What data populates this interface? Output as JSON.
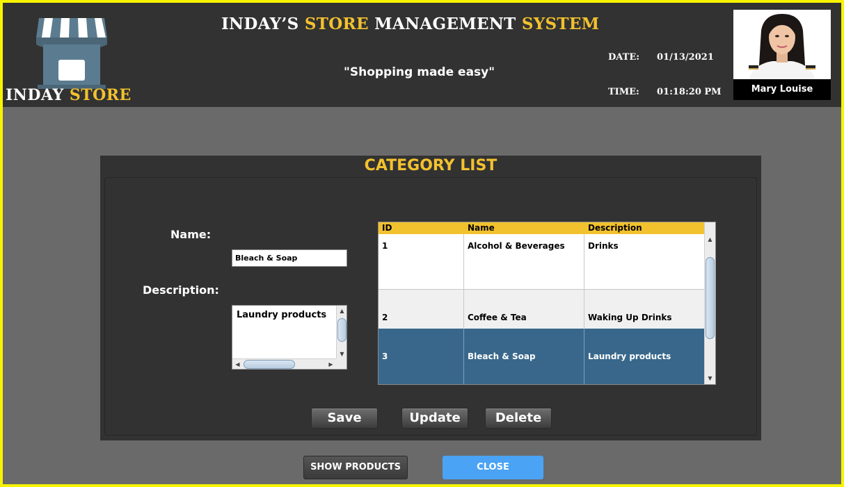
{
  "header": {
    "logo_text": {
      "part1": "INDAY ",
      "part2": "STORE"
    },
    "title": {
      "w1": "INDAY’S ",
      "w2": "STORE",
      "w3": " MANAGEMENT ",
      "w4": "SYSTEM"
    },
    "tagline": "\"Shopping made easy\"",
    "date_label": "DATE:",
    "date_value": "01/13/2021",
    "time_label": "TIME:",
    "time_value": "01:18:20 PM",
    "user_name": "Mary Louise"
  },
  "category_panel": {
    "title": "CATEGORY LIST",
    "name_label": "Name:",
    "name_value": "Bleach & Soap",
    "description_label": "Description:",
    "description_value": "Laundry products"
  },
  "table": {
    "columns": [
      "ID",
      "Name",
      "Description"
    ],
    "rows": [
      {
        "id": "1",
        "name": "Alcohol & Beverages",
        "description": "Drinks"
      },
      {
        "id": "2",
        "name": "Coffee & Tea",
        "description": "Waking  Up Drinks"
      },
      {
        "id": "3",
        "name": "Bleach & Soap",
        "description": "Laundry products"
      }
    ],
    "selected_id": "3"
  },
  "actions": {
    "save": "Save",
    "update": "Update",
    "delete": "Delete",
    "show_products": "SHOW PRODUCTS",
    "close": "CLOSE"
  },
  "colors": {
    "accent_yellow": "#f2c12e",
    "header_bg": "#323232",
    "body_bg": "#6a6a6a",
    "selected_row": "#38678b",
    "close_button": "#4aa3f4",
    "window_border": "#f8f400"
  },
  "icons": {
    "logo": "storefront-icon"
  }
}
